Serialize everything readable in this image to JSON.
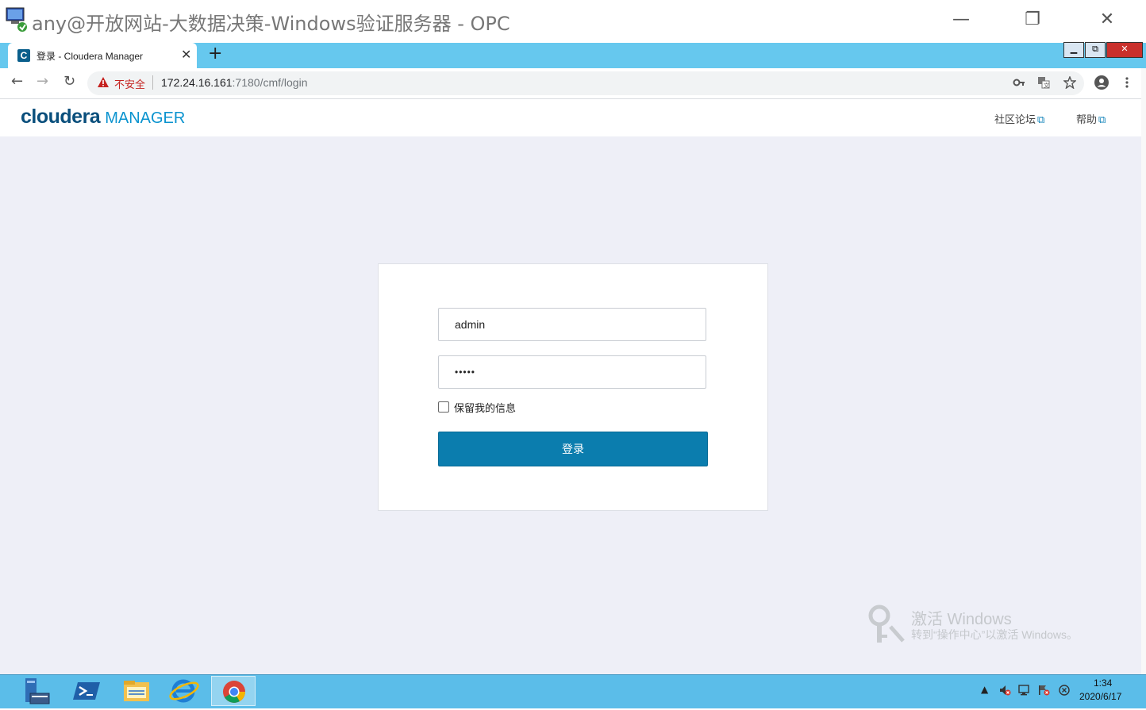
{
  "rdp_window": {
    "title": "any@开放网站-大数据决策-Windows验证服务器 - OPC",
    "minimize_glyph": "—",
    "maximize_glyph": "❐",
    "close_glyph": "✕",
    "icon": "remote-desktop-icon"
  },
  "browser": {
    "tab": {
      "favicon_letter": "C",
      "title": "登录 - Cloudera Manager",
      "close_glyph": "✕"
    },
    "new_tab_glyph": "+",
    "inner_window_controls": [
      "▁",
      "⧉",
      "✕"
    ],
    "nav": {
      "back": "←",
      "forward": "→",
      "reload": "↻"
    },
    "address": {
      "security_label": "不安全",
      "host": "172.24.16.161",
      "path": ":7180/cmf/login"
    },
    "toolbar_icons": [
      "key-icon",
      "translate-icon",
      "star-icon",
      "account-icon",
      "menu-icon"
    ]
  },
  "app_header": {
    "brand": "cloudera",
    "product": "MANAGER",
    "links": [
      {
        "label": "社区论坛",
        "icon": "external-link-icon"
      },
      {
        "label": "帮助",
        "icon": "external-link-icon"
      }
    ]
  },
  "login": {
    "username_value": "admin",
    "password_value": "•••••",
    "remember_label": "保留我的信息",
    "remember_checked": false,
    "submit_label": "登录"
  },
  "watermark": {
    "line1": "激活 Windows",
    "line2": "转到“操作中心”以激活 Windows。"
  },
  "taskbar": {
    "apps": [
      "server-manager-icon",
      "powershell-icon",
      "file-explorer-icon",
      "internet-explorer-icon",
      "chrome-icon"
    ],
    "active_app": "chrome-icon",
    "time": "1:34",
    "date": "2020/6/17"
  },
  "colors": {
    "tab_strip": "#66c8ee",
    "primary_button": "#0b7dae",
    "brand": "#0a4f7c",
    "product": "#0a93cf",
    "insecure": "#c5221f",
    "taskbar": "#5bbde9"
  }
}
